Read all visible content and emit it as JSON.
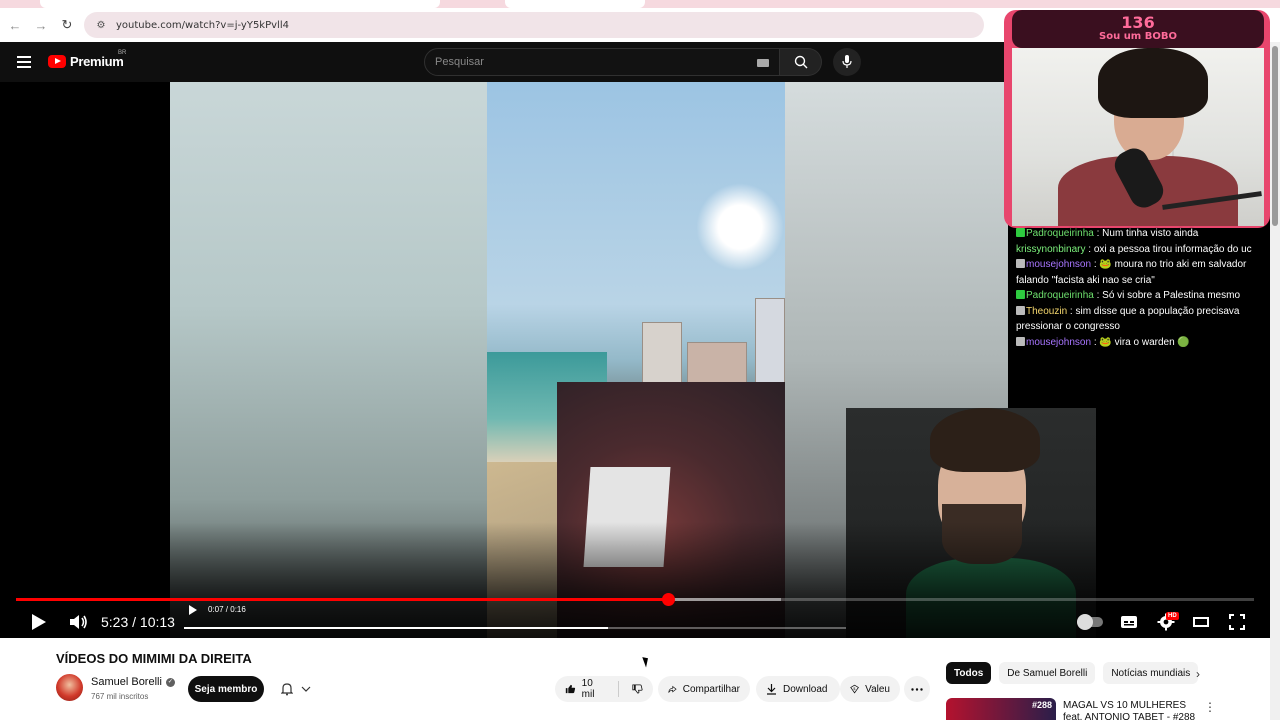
{
  "browser": {
    "url": "youtube.com/watch?v=j-yY5kPvll4"
  },
  "header": {
    "brand": "Premium",
    "region": "BR",
    "search_placeholder": "Pesquisar"
  },
  "player": {
    "time_display": "5:23 / 10:13",
    "progress_fraction": 0.527,
    "buffered_fraction": 0.618,
    "inner_clip": {
      "time_display": "0:07 / 0:16",
      "progress_fraction": 0.64
    },
    "quality_badge": "HD"
  },
  "overlay": {
    "count": "136",
    "caption": "Sou um BOBO"
  },
  "chat": [
    {
      "badge": "green",
      "user": "Padroqueirinha",
      "user_color": "#6ee06e",
      "text": ": Num tinha visto ainda"
    },
    {
      "badge": "",
      "user": "krissynonbinary",
      "user_color": "#7cf07c",
      "text": ": oxi a pessoa tirou informação do uc"
    },
    {
      "badge": "gray",
      "user": "mousejohnson",
      "user_color": "#a875ff",
      "text": ": 🐸 moura no trio aki em salvador falando \"facista aki nao se cria\""
    },
    {
      "badge": "green",
      "user": "Padroqueirinha",
      "user_color": "#6ee06e",
      "text": ": Só vi sobre a Palestina mesmo"
    },
    {
      "badge": "gray",
      "user": "Theouzin",
      "user_color": "#f5d76e",
      "text": ": sim disse que a população precisava pressionar o congresso"
    },
    {
      "badge": "gray",
      "user": "mousejohnson",
      "user_color": "#a875ff",
      "text": ": 🐸 vira o warden 🟢"
    }
  ],
  "video": {
    "title": "VÍDEOS DO MIMIMI DA DIREITA",
    "channel": "Samuel Borelli",
    "subscribers": "767 mil inscritos",
    "member_label": "Seja membro",
    "likes": "10 mil",
    "share_label": "Compartilhar",
    "download_label": "Download",
    "thanks_label": "Valeu"
  },
  "chips": [
    "Todos",
    "De Samuel Borelli",
    "Notícias mundiais"
  ],
  "recommendation": {
    "thumb_number": "#288",
    "title": "MAGAL VS 10 MULHERES feat. ANTONIO TABET - #288"
  }
}
